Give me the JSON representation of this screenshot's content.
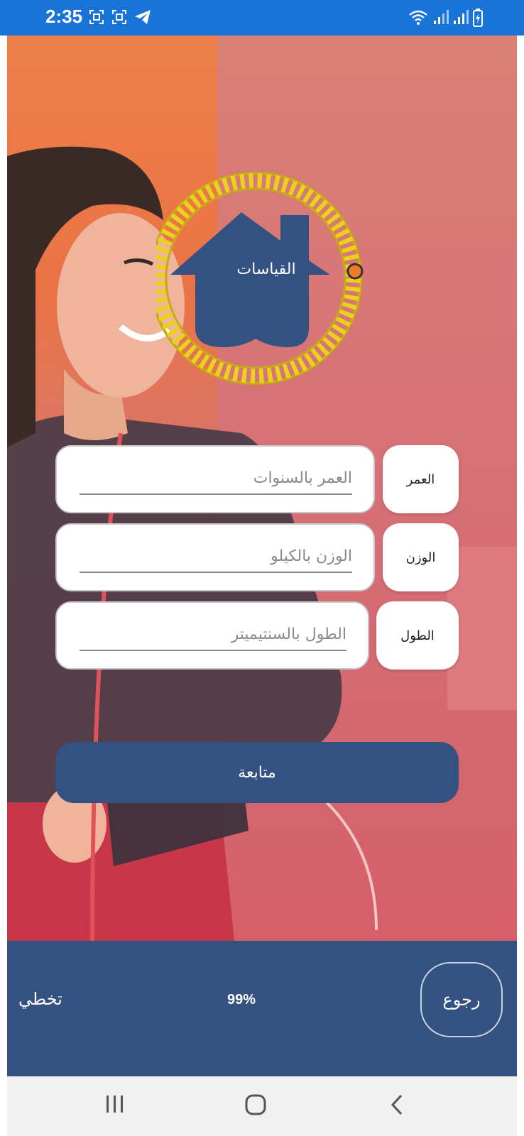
{
  "status_bar": {
    "time": "2:35",
    "icons_left": [
      "screenshot-icon",
      "screenshot-icon",
      "telegram-icon"
    ],
    "icons_right": [
      "wifi-icon",
      "signal-icon",
      "signal-icon",
      "battery-charging-icon"
    ]
  },
  "logo": {
    "title": "القياسات",
    "icon": "house-measuring-tape-icon"
  },
  "form": {
    "age": {
      "label": "العمر",
      "placeholder": "العمر بالسنوات",
      "value": ""
    },
    "weight": {
      "label": "الوزن",
      "placeholder": "الوزن بالكيلو",
      "value": ""
    },
    "height": {
      "label": "الطول",
      "placeholder": "الطول بالسنتيميتر",
      "value": ""
    },
    "continue_label": "متابعة"
  },
  "bottom_bar": {
    "skip_label": "تخطي",
    "progress": "99%",
    "back_label": "رجوع"
  },
  "nav_bar": {
    "icons": [
      "recent-apps-icon",
      "home-icon",
      "back-icon"
    ]
  },
  "colors": {
    "primary": "#335282",
    "status_bar": "#1a73d6",
    "tape_yellow": "#e8d21e"
  }
}
